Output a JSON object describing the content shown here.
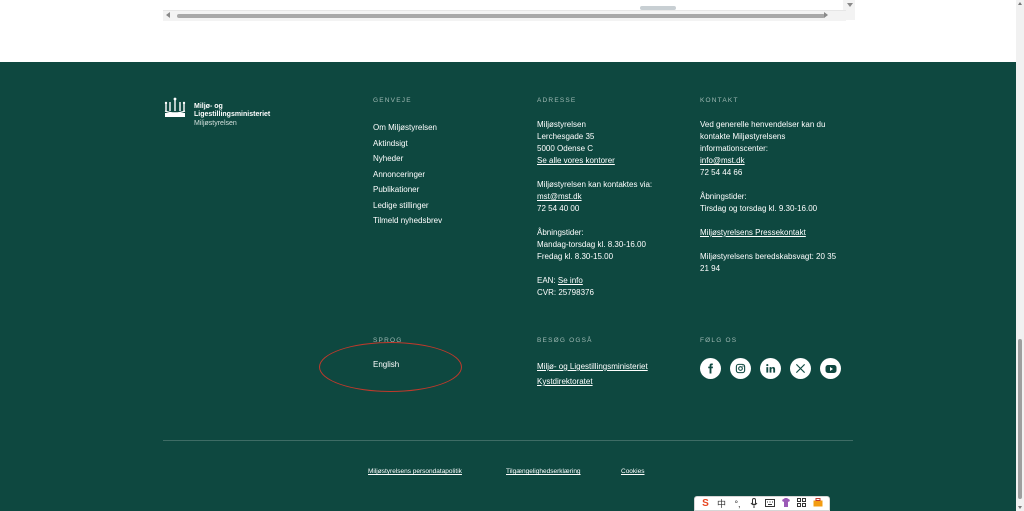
{
  "logo": {
    "ministry_line1": "Miljø- og",
    "ministry_line2": "Ligestillingsministeriet",
    "agency": "Miljøstyrelsen"
  },
  "genveje": {
    "heading": "GENVEJE",
    "items": [
      "Om Miljøstyrelsen",
      "Aktindsigt",
      "Nyheder",
      "Annonceringer",
      "Publikationer",
      "Ledige stillinger",
      "Tilmeld nyhedsbrev"
    ]
  },
  "adresse": {
    "heading": "ADRESSE",
    "name": "Miljøstyrelsen",
    "street": "Lerchesgade 35",
    "city": "5000 Odense C",
    "offices_link": "Se alle vores kontorer",
    "contact_intro": "Miljøstyrelsen kan kontaktes via:",
    "email": "mst@mst.dk",
    "phone": "72 54 40 00",
    "hours_label": "Åbningstider:",
    "hours_1": "Mandag-torsdag kl. 8.30-16.00",
    "hours_2": "Fredag kl. 8.30-15.00",
    "ean_label": "EAN:",
    "ean_link": "Se info",
    "cvr": "CVR: 25798376"
  },
  "kontakt": {
    "heading": "KONTAKT",
    "intro_1": "Ved generelle henvendelser kan du",
    "intro_2": "kontakte Miljøstyrelsens",
    "intro_3": "informationscenter:",
    "email": "info@mst.dk",
    "phone": "72 54 44 66",
    "hours_label": "Åbningstider:",
    "hours": "Tirsdag og torsdag kl. 9.30-16.00",
    "press_link": "Miljøstyrelsens Pressekontakt",
    "emergency_1": "Miljøstyrelsens beredskabsvagt: 20 35",
    "emergency_2": "21 94"
  },
  "sprog": {
    "heading": "SPROG",
    "english": "English"
  },
  "besog": {
    "heading": "BESØG OGSÅ",
    "link1": "Miljø- og Ligestillingsministeriet",
    "link2": "Kystdirektoratet"
  },
  "folg": {
    "heading": "FØLG OS",
    "icons": [
      "facebook-icon",
      "instagram-icon",
      "linkedin-icon",
      "x-icon",
      "youtube-icon"
    ]
  },
  "bottom": {
    "privacy": "Miljøstyrelsens persondatapolitik",
    "accessibility": "Tilgængelighedserklæring",
    "cookies": "Cookies"
  },
  "ime": {
    "lang": "中"
  },
  "colors": {
    "footer_bg": "#0e4840",
    "heading": "#9fb9b3",
    "annotation": "#c0392b"
  }
}
